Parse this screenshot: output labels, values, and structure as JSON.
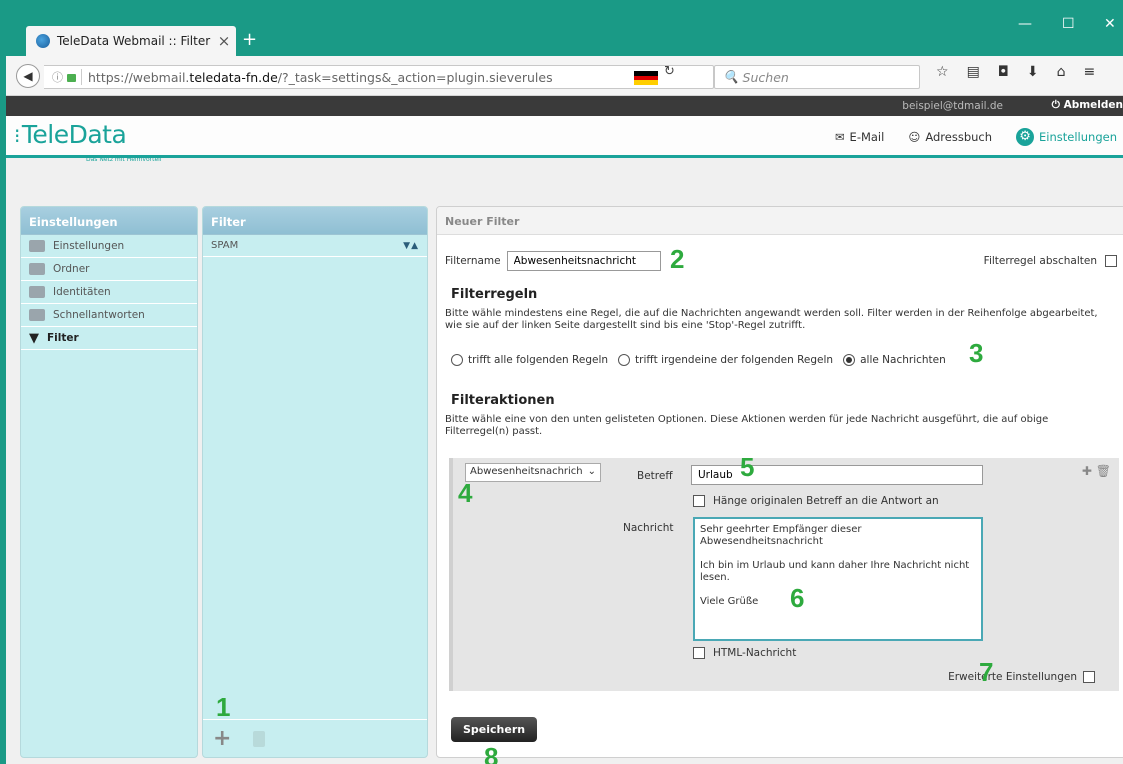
{
  "browser": {
    "tab_title": "TeleData Webmail :: Filter",
    "url_prefix": "https://webmail.",
    "url_host": "teledata-fn.de",
    "url_path": "/?_task=settings&_action=plugin.sieverules",
    "search_placeholder": "Suchen"
  },
  "topbar": {
    "user": "beispiel@tdmail.de",
    "logout": "Abmelden"
  },
  "header": {
    "logo": "TeleData",
    "tagline": "Das Netz mit Heimvorteil",
    "nav": [
      {
        "label": "E-Mail"
      },
      {
        "label": "Adressbuch"
      },
      {
        "label": "Einstellungen"
      }
    ]
  },
  "settings_panel": {
    "title": "Einstellungen",
    "items": [
      {
        "label": "Einstellungen"
      },
      {
        "label": "Ordner"
      },
      {
        "label": "Identitäten"
      },
      {
        "label": "Schnellantworten"
      },
      {
        "label": "Filter"
      }
    ]
  },
  "filter_panel": {
    "title": "Filter",
    "items": [
      {
        "label": "SPAM"
      }
    ]
  },
  "form": {
    "title": "Neuer Filter",
    "name_label": "Filtername",
    "name_value": "Abwesenheitsnachricht",
    "disable_label": "Filterregel abschalten",
    "rules_heading": "Filterregeln",
    "rules_text": "Bitte wähle mindestens eine Regel, die auf die Nachrichten angewandt werden soll. Filter werden in der Reihenfolge abgearbeitet, wie sie auf der linken Seite dargestellt sind bis eine 'Stop'-Regel zutrifft.",
    "radio_all": "trifft alle folgenden Regeln",
    "radio_any": "trifft irgendeine der folgenden Regeln",
    "radio_every": "alle Nachrichten",
    "actions_heading": "Filteraktionen",
    "actions_text": "Bitte wähle eine von den unten gelisteten Optionen. Diese Aktionen werden für jede Nachricht ausgeführt, die auf obige Filterregel(n) passt.",
    "action_select": "Abwesenheitsnachrich",
    "subject_label": "Betreff",
    "subject_value": "Urlaub",
    "copy_subject_label": "Hänge originalen Betreff an die Antwort an",
    "message_label": "Nachricht",
    "message_value": "Sehr geehrter Empfänger dieser Abwesendheitsnachricht\n\nIch bin im Urlaub und kann daher Ihre Nachricht nicht lesen.\n\nViele Grüße",
    "html_label": "HTML-Nachricht",
    "advanced_label": "Erweiterte Einstellungen",
    "save_label": "Speichern"
  },
  "annotations": [
    "1",
    "2",
    "3",
    "4",
    "5",
    "6",
    "7",
    "8"
  ]
}
